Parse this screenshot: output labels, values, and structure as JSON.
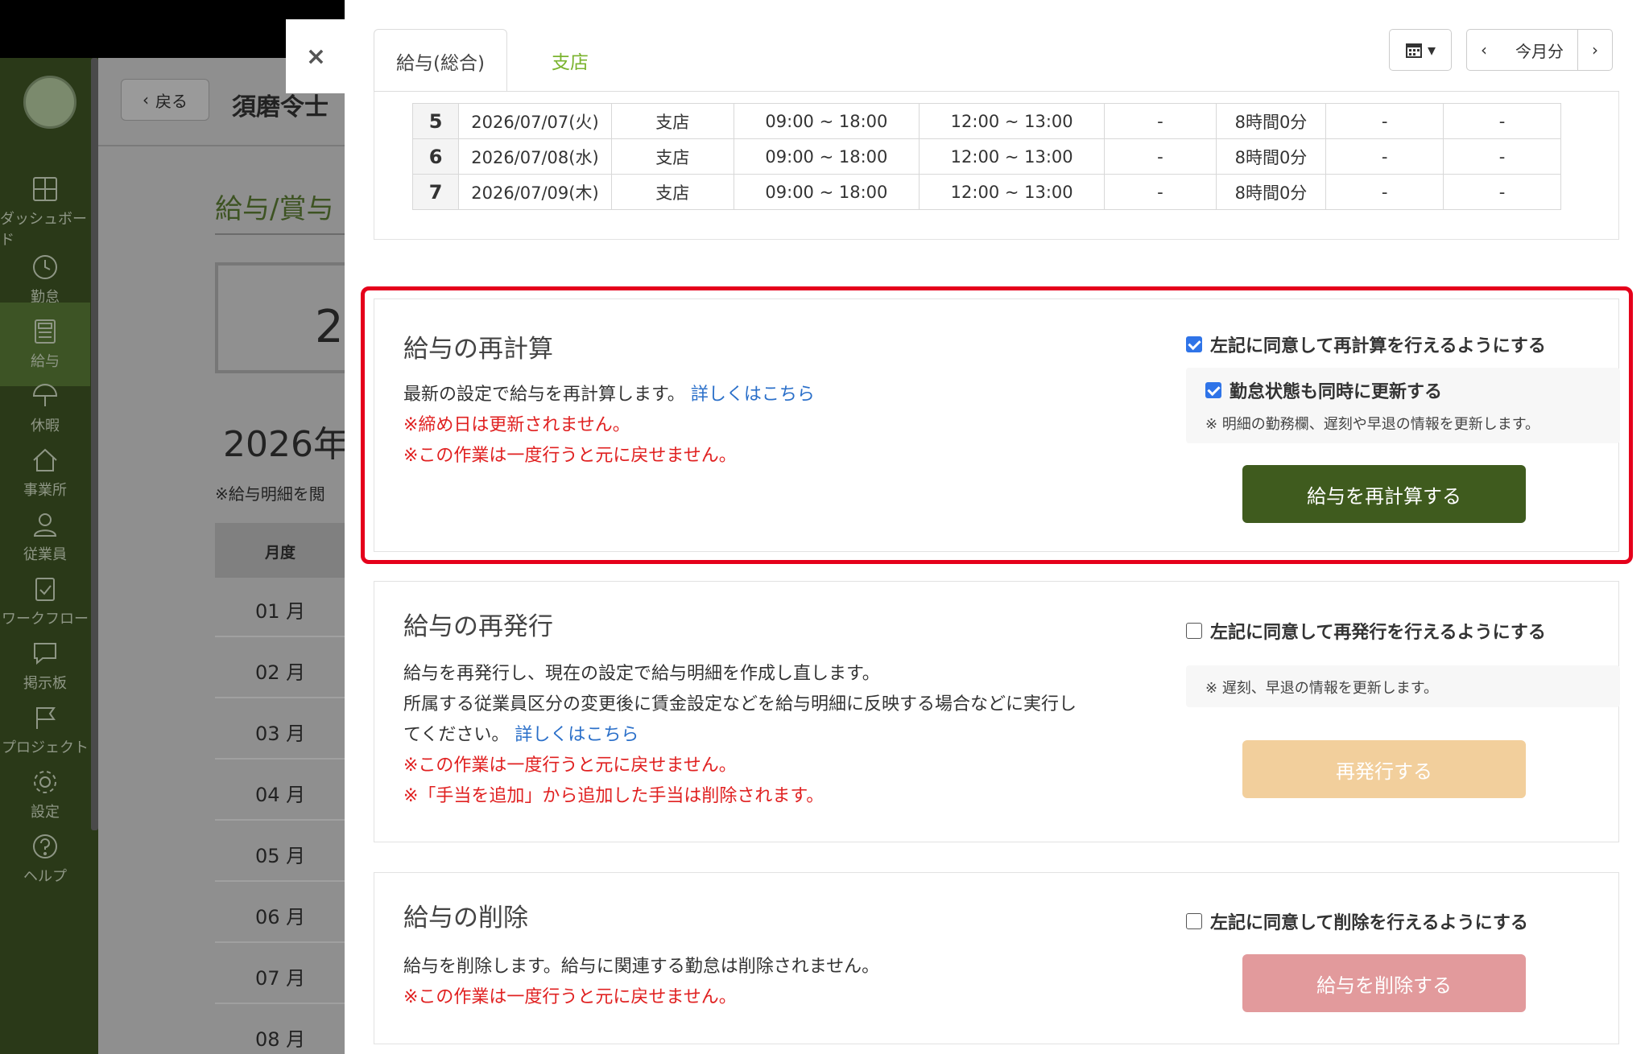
{
  "sidebar": {
    "items": [
      {
        "label": "ダッシュボード",
        "icon": "dashboard-icon"
      },
      {
        "label": "勤怠",
        "icon": "clock-icon"
      },
      {
        "label": "給与",
        "icon": "calculator-icon"
      },
      {
        "label": "休暇",
        "icon": "umbrella-icon"
      },
      {
        "label": "事業所",
        "icon": "home-icon"
      },
      {
        "label": "従業員",
        "icon": "person-icon"
      },
      {
        "label": "ワークフロー",
        "icon": "clipboard-check-icon"
      },
      {
        "label": "掲示板",
        "icon": "chat-icon"
      },
      {
        "label": "プロジェクト",
        "icon": "flag-icon"
      },
      {
        "label": "設定",
        "icon": "gear-icon"
      },
      {
        "label": "ヘルプ",
        "icon": "help-icon"
      }
    ]
  },
  "background": {
    "back_label": "戻る",
    "person_name": "須磨令士",
    "section_title": "給与/賞与",
    "box_value": "2",
    "year": "2026年",
    "note": "※給与明細を閲",
    "month_header": "月度",
    "months": [
      "01 月",
      "02 月",
      "03 月",
      "04 月",
      "05 月",
      "06 月",
      "07 月",
      "08 月"
    ]
  },
  "modal": {
    "close_glyph": "×",
    "tabs": [
      "給与(総合)",
      "支店"
    ],
    "period_label": "今月分",
    "prev_glyph": "‹",
    "next_glyph": "›",
    "table_rows": [
      [
        "5",
        "2026/07/07(火)",
        "支店",
        "09:00 ~ 18:00",
        "12:00 ~ 13:00",
        "-",
        "8時間0分",
        "-",
        "-"
      ],
      [
        "6",
        "2026/07/08(水)",
        "支店",
        "09:00 ~ 18:00",
        "12:00 ~ 13:00",
        "-",
        "8時間0分",
        "-",
        "-"
      ],
      [
        "7",
        "2026/07/09(木)",
        "支店",
        "09:00 ~ 18:00",
        "12:00 ~ 13:00",
        "-",
        "8時間0分",
        "-",
        "-"
      ]
    ],
    "recalc": {
      "title": "給与の再計算",
      "desc": "最新の設定で給与を再計算します。",
      "link": "詳しくはこちら",
      "warnings": [
        "※締め日は更新されません。",
        "※この作業は一度行うと元に戻せません。"
      ],
      "agree_label": "左記に同意して再計算を行えるようにする",
      "agree_checked": true,
      "sub_label": "勤怠状態も同時に更新する",
      "sub_checked": true,
      "sub_note": "※ 明細の勤務欄、遅刻や早退の情報を更新します。",
      "button": "給与を再計算する"
    },
    "reissue": {
      "title": "給与の再発行",
      "desc_lines": [
        "給与を再発行し、現在の設定で給与明細を作成し直します。",
        "所属する従業員区分の変更後に賃金設定などを給与明細に反映する場合などに実行し",
        "てください。"
      ],
      "link": "詳しくはこちら",
      "warnings": [
        "※この作業は一度行うと元に戻せません。",
        "※「手当を追加」から追加した手当は削除されます。"
      ],
      "agree_label": "左記に同意して再発行を行えるようにする",
      "agree_checked": false,
      "sub_note": "※ 遅刻、早退の情報を更新します。",
      "button": "再発行する"
    },
    "delete": {
      "title": "給与の削除",
      "desc": "給与を削除します。給与に関連する勤怠は削除されません。",
      "warnings": [
        "※この作業は一度行うと元に戻せません。"
      ],
      "agree_label": "左記に同意して削除を行えるようにする",
      "agree_checked": false,
      "button": "給与を削除する"
    }
  },
  "colors": {
    "accent_green": "#3f5b1e",
    "tab_green": "#7ab32e",
    "warning_red": "#e02020",
    "link_blue": "#2a6fc9",
    "highlight_red": "#e5001b"
  }
}
